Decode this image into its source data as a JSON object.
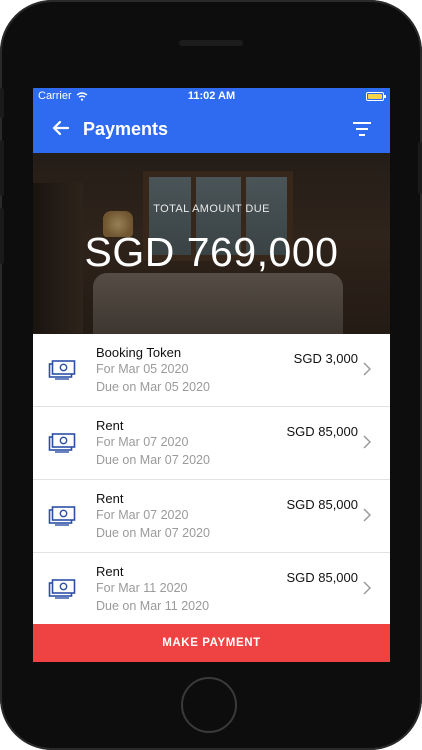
{
  "status_bar": {
    "carrier": "Carrier",
    "time": "11:02 AM"
  },
  "nav": {
    "title": "Payments",
    "back_icon": "arrow-left-icon",
    "filter_icon": "filter-icon"
  },
  "summary": {
    "label": "TOTAL AMOUNT DUE",
    "amount": "SGD 769,000"
  },
  "payments": [
    {
      "name": "Booking Token",
      "for": "For Mar 05 2020",
      "due": "Due on Mar 05 2020",
      "amount": "SGD 3,000"
    },
    {
      "name": "Rent",
      "for": "For Mar 07 2020",
      "due": "Due on Mar 07 2020",
      "amount": "SGD 85,000"
    },
    {
      "name": "Rent",
      "for": "For Mar 07 2020",
      "due": "Due on Mar 07 2020",
      "amount": "SGD 85,000"
    },
    {
      "name": "Rent",
      "for": "For Mar 11 2020",
      "due": "Due on Mar 11 2020",
      "amount": "SGD 85,000"
    }
  ],
  "action": {
    "make_payment": "MAKE PAYMENT"
  },
  "colors": {
    "primary": "#2F6BF0",
    "accent": "#EF4242",
    "icon": "#2C4FA6"
  }
}
